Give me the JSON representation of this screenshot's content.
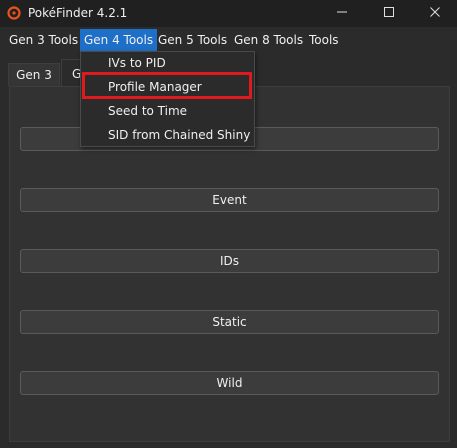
{
  "window": {
    "title": "PokéFinder 4.2.1",
    "icon": "pokeball-icon",
    "controls": [
      "minimize-icon",
      "maximize-icon",
      "close-icon"
    ]
  },
  "menubar": {
    "items": [
      {
        "label": "Gen 3 Tools"
      },
      {
        "label": "Gen 4 Tools"
      },
      {
        "label": "Gen 5 Tools"
      },
      {
        "label": "Gen 8 Tools"
      },
      {
        "label": "Tools"
      }
    ],
    "active_index": 1
  },
  "dropdown": {
    "items": [
      {
        "label": "IVs to PID"
      },
      {
        "label": "Profile Manager"
      },
      {
        "label": "Seed to Time"
      },
      {
        "label": "SID from Chained Shiny"
      }
    ],
    "highlighted_index": 1,
    "highlight_color": "#e0191f"
  },
  "tabs": [
    {
      "label": "Gen 3"
    },
    {
      "label": "G"
    }
  ],
  "panel": {
    "buttons": [
      {
        "label": "…"
      },
      {
        "label": "Event"
      },
      {
        "label": "IDs"
      },
      {
        "label": "Static"
      },
      {
        "label": "Wild"
      }
    ]
  },
  "colors": {
    "accent": "#1e6fc7",
    "background": "#2b2b2b",
    "titlebar": "#202020"
  }
}
